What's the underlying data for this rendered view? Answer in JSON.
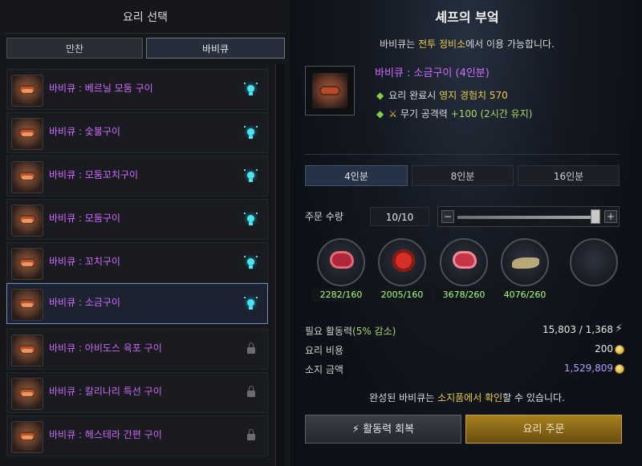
{
  "left": {
    "title": "요리 선택",
    "tabs": [
      {
        "label": "만찬",
        "active": false
      },
      {
        "label": "바비큐",
        "active": true
      }
    ],
    "recipes": [
      {
        "name": "바비큐 : 베르닐 모둠 구이",
        "status": "available"
      },
      {
        "name": "바비큐 : 숯불구이",
        "status": "available"
      },
      {
        "name": "바비큐 : 모둠꼬치구이",
        "status": "available"
      },
      {
        "name": "바비큐 : 모둠구이",
        "status": "available"
      },
      {
        "name": "바비큐 : 꼬치구이",
        "status": "available"
      },
      {
        "name": "바비큐 : 소금구이",
        "status": "available",
        "selected": true
      },
      {
        "name": "바비큐 : 아비도스 육포 구이",
        "status": "locked"
      },
      {
        "name": "바비큐 : 칼리나리 특선 구이",
        "status": "locked"
      },
      {
        "name": "바비큐 : 헤스테라 간편 구이",
        "status": "locked"
      }
    ]
  },
  "right": {
    "title": "셰프의 부엌",
    "subtitle_pre": "바비큐는 ",
    "subtitle_hl": "전투 정비소",
    "subtitle_post": "에서 이용 가능합니다.",
    "dish": {
      "name": "바비큐 : 소금구이 (4인분)",
      "effect1_label": "요리 완료시 ",
      "effect1_value": "영지 경험치 570",
      "effect2_label": "무기 공격력 ",
      "effect2_value": "+100 (2시간 유지)"
    },
    "portions": [
      "4인분",
      "8인분",
      "16인분"
    ],
    "quantity_label": "주문 수량",
    "quantity_value": "10/10",
    "slider": {
      "minus": "−",
      "plus": "+",
      "level": 1.0
    },
    "materials": [
      {
        "amount": "2282/160"
      },
      {
        "amount": "2005/160"
      },
      {
        "amount": "3678/260"
      },
      {
        "amount": "4076/260"
      },
      {
        "amount": ""
      }
    ],
    "stats": {
      "energy_label": "필요 활동력",
      "energy_discount": "(5% 감소)",
      "energy_value": "15,803 / 1,368",
      "cost_label": "요리 비용",
      "cost_value": "200",
      "held_label": "소지 금액",
      "held_value": "1,529,809"
    },
    "note_pre": "완성된 바비큐는 ",
    "note_hl": "소지품에서 확인",
    "note_post": "할 수 있습니다.",
    "btn_recover": "활동력 회복",
    "btn_order": "요리 주문"
  },
  "colors": {
    "accent_purple": "#d26bff",
    "gold": "#e8c94c",
    "green": "#a8ff7a"
  }
}
